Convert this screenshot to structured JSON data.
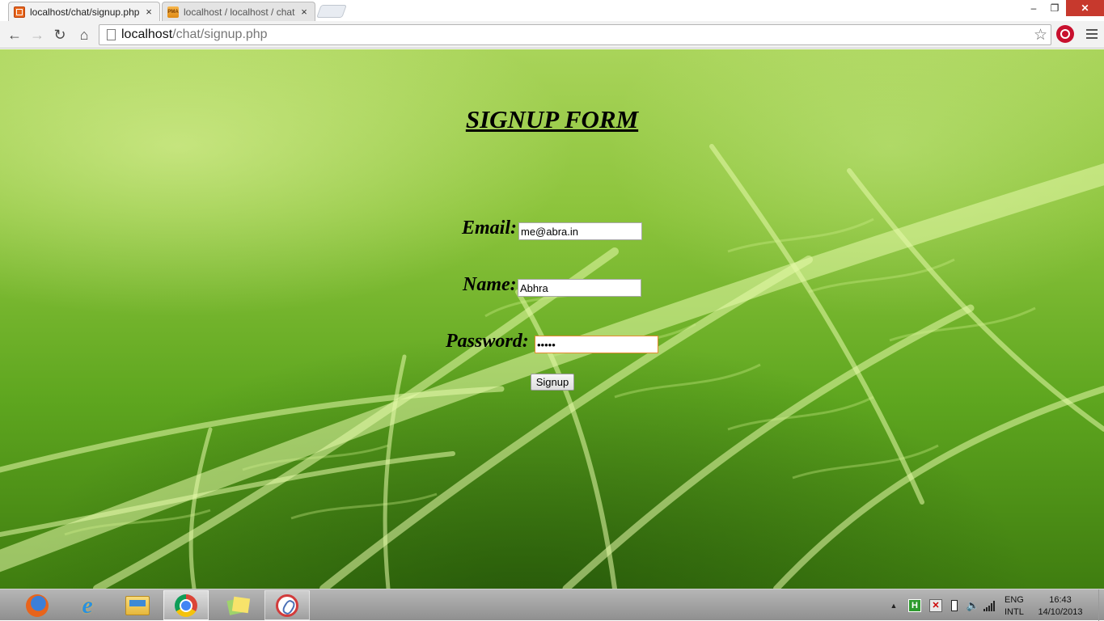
{
  "browser": {
    "tabs": [
      {
        "title": "localhost/chat/signup.php",
        "favicon": "xampp-icon",
        "active": true
      },
      {
        "title": "localhost / localhost / chat",
        "favicon": "phpmyadmin-icon",
        "active": false
      }
    ],
    "tab_close_glyph": "×",
    "window_controls": {
      "minimize": "–",
      "maximize": "❐",
      "close": "✕"
    },
    "nav": {
      "back": "←",
      "forward": "→",
      "reload": "↻",
      "home": "⌂"
    },
    "url_host": "localhost",
    "url_path": "/chat/signup.php",
    "star": "☆"
  },
  "page": {
    "heading": "SIGNUP FORM",
    "email_label": "Email:",
    "email_value": "me@abra.in",
    "name_label": "Name:",
    "name_value": "Abhra",
    "password_label": "Password:",
    "password_value": "passw",
    "signup_button": "Signup"
  },
  "taskbar": {
    "apps": [
      "firefox-icon",
      "internet-explorer-icon",
      "file-explorer-icon",
      "chrome-icon",
      "sticky-notes-icon",
      "snipping-tool-icon"
    ],
    "active_app": "chrome-icon",
    "tray_arrow": "▲",
    "language": "ENG",
    "layout": "INTL",
    "time": "16:43",
    "date": "14/10/2013"
  },
  "colors": {
    "close_button": "#c7392d",
    "background_green": "#8cc43c",
    "focus_border": "#e58b2e"
  }
}
